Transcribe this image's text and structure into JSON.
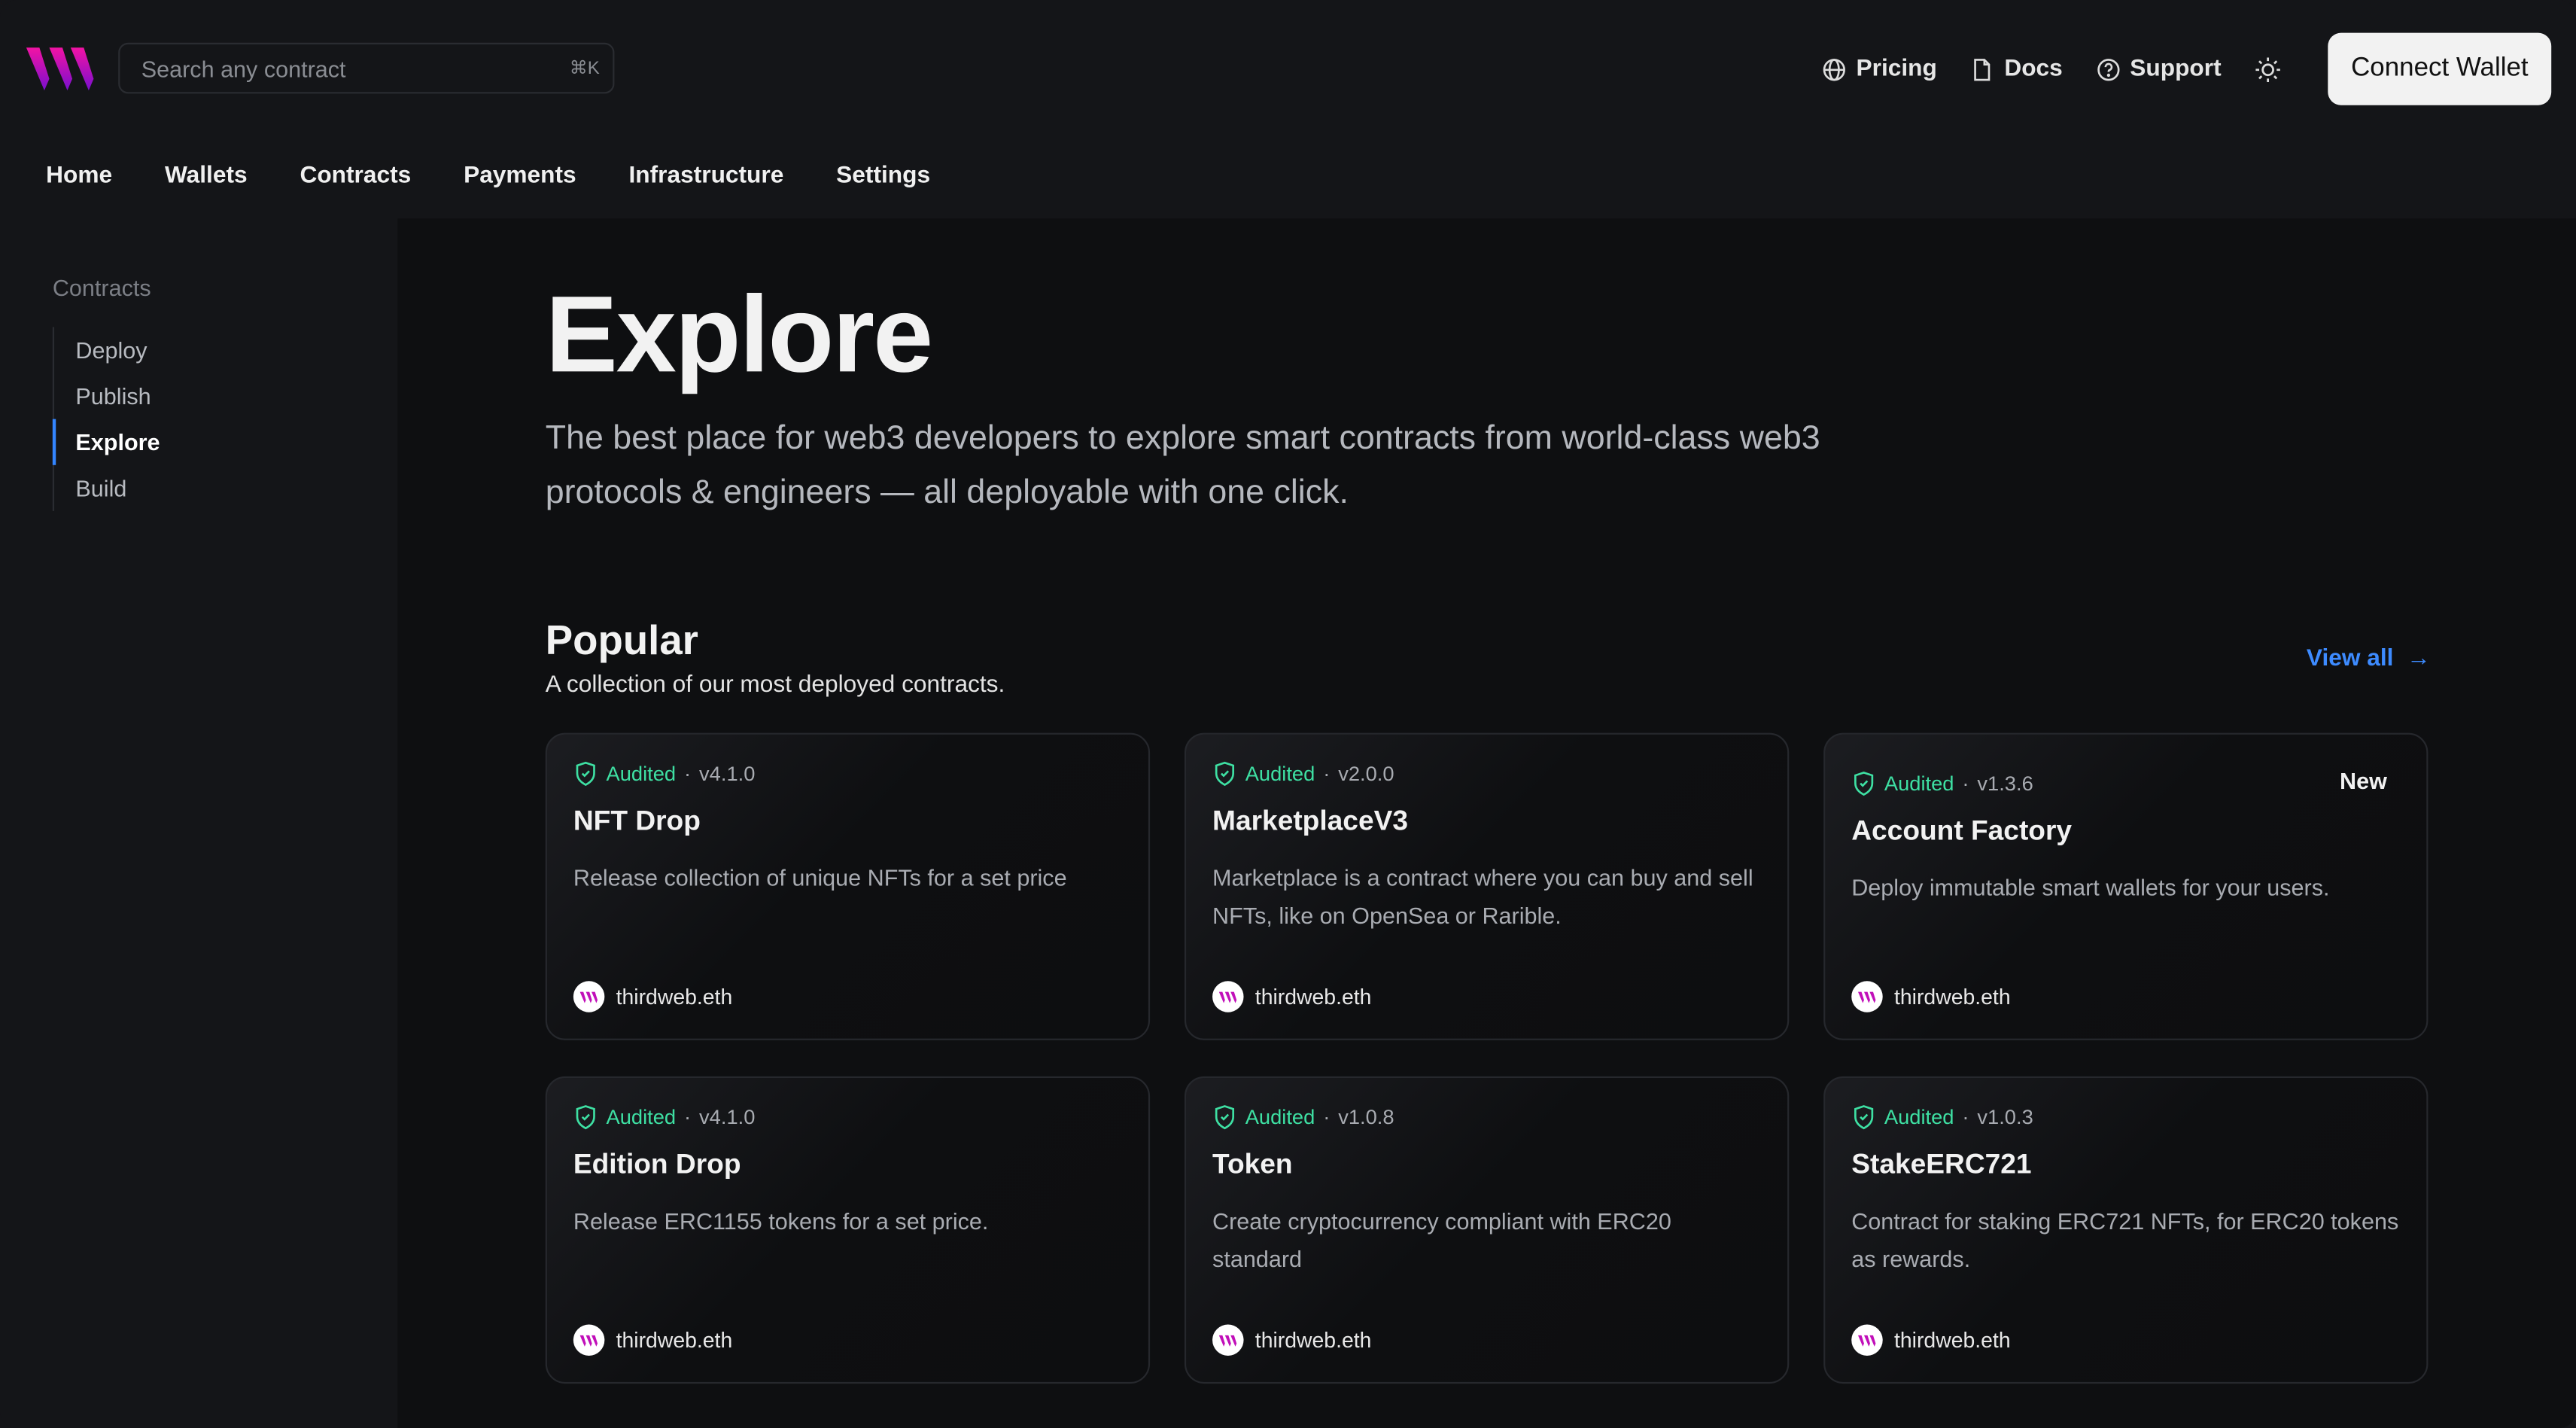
{
  "header": {
    "search_placeholder": "Search any contract",
    "search_shortcut": "⌘K",
    "links": [
      {
        "label": "Pricing",
        "icon": "globe-icon"
      },
      {
        "label": "Docs",
        "icon": "document-icon"
      },
      {
        "label": "Support",
        "icon": "help-circle-icon"
      }
    ],
    "theme_icon": "sun-icon",
    "connect_label": "Connect Wallet"
  },
  "nav": [
    "Home",
    "Wallets",
    "Contracts",
    "Payments",
    "Infrastructure",
    "Settings"
  ],
  "sidebar": {
    "heading": "Contracts",
    "items": [
      "Deploy",
      "Publish",
      "Explore",
      "Build"
    ],
    "active": "Explore"
  },
  "page": {
    "title": "Explore",
    "subtitle": "The best place for web3 developers to explore smart contracts from world-class web3 protocols & engineers — all deployable with one click."
  },
  "popular": {
    "title": "Popular",
    "subtitle": "A collection of our most deployed contracts.",
    "view_all": "View all"
  },
  "colors": {
    "accent": "#3d8bff",
    "audited": "#3ee0a3",
    "brand_pink": "#f213a4",
    "brand_purple": "#7a0fcf"
  },
  "cards": [
    {
      "audited": "Audited",
      "version": "v4.1.0",
      "name": "NFT Drop",
      "desc": "Release collection of unique NFTs for a set price",
      "author": "thirdweb.eth",
      "tag": ""
    },
    {
      "audited": "Audited",
      "version": "v2.0.0",
      "name": "MarketplaceV3",
      "desc": "Marketplace is a contract where you can buy and sell NFTs, like on OpenSea or Rarible.",
      "author": "thirdweb.eth",
      "tag": ""
    },
    {
      "audited": "Audited",
      "version": "v1.3.6",
      "name": "Account Factory",
      "desc": "Deploy immutable smart wallets for your users.",
      "author": "thirdweb.eth",
      "tag": "New"
    },
    {
      "audited": "Audited",
      "version": "v4.1.0",
      "name": "Edition Drop",
      "desc": "Release ERC1155 tokens for a set price.",
      "author": "thirdweb.eth",
      "tag": ""
    },
    {
      "audited": "Audited",
      "version": "v1.0.8",
      "name": "Token",
      "desc": "Create cryptocurrency compliant with ERC20 standard",
      "author": "thirdweb.eth",
      "tag": ""
    },
    {
      "audited": "Audited",
      "version": "v1.0.3",
      "name": "StakeERC721",
      "desc": "Contract for staking ERC721 NFTs, for ERC20 tokens as rewards.",
      "author": "thirdweb.eth",
      "tag": ""
    }
  ]
}
